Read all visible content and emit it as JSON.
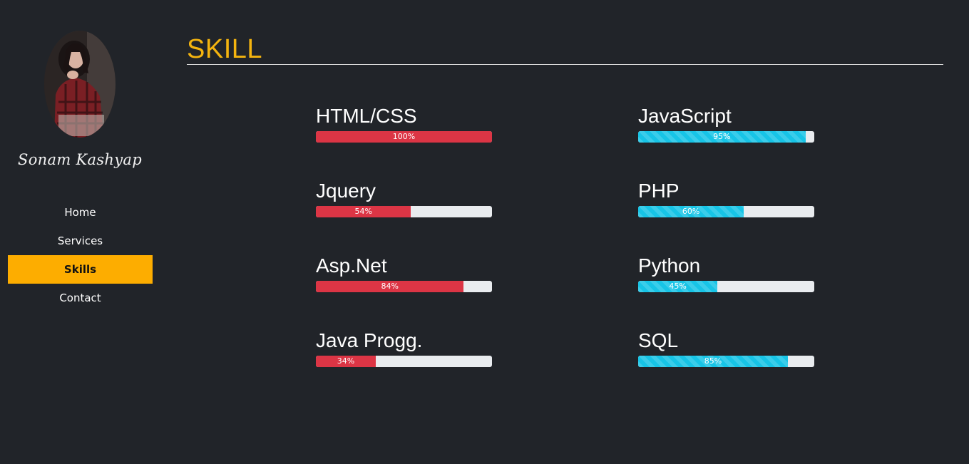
{
  "sidebar": {
    "name": "Sonam Kashyap",
    "nav": [
      {
        "label": "Home",
        "active": false
      },
      {
        "label": "Services",
        "active": false
      },
      {
        "label": "Skills",
        "active": true
      },
      {
        "label": "Contact",
        "active": false
      }
    ]
  },
  "main": {
    "title": "SKILL"
  },
  "skills": {
    "left": [
      {
        "name": "HTML/CSS",
        "percent": 100,
        "label": "100%"
      },
      {
        "name": "Jquery",
        "percent": 54,
        "label": "54%"
      },
      {
        "name": "Asp.Net",
        "percent": 84,
        "label": "84%"
      },
      {
        "name": "Java Progg.",
        "percent": 34,
        "label": "34%"
      }
    ],
    "right": [
      {
        "name": "JavaScript",
        "percent": 95,
        "label": "95%"
      },
      {
        "name": "PHP",
        "percent": 60,
        "label": "60%"
      },
      {
        "name": "Python",
        "percent": 45,
        "label": "45%"
      },
      {
        "name": "SQL",
        "percent": 85,
        "label": "85%"
      }
    ]
  },
  "colors": {
    "background": "#212429",
    "accent": "#fdad00",
    "title": "#f4b40f",
    "bar_left": "#dc3545",
    "bar_right": "#17c4e6",
    "track": "#e9ecef"
  },
  "icons": {
    "avatar": "profile-photo"
  }
}
